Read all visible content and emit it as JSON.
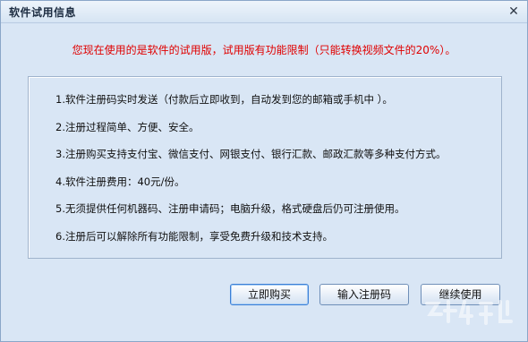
{
  "window": {
    "title": "软件试用信息",
    "close_glyph": "✕"
  },
  "notice": "您现在使用的是软件的试用版，试用版有功能限制（只能转换视频文件的20%）。",
  "info_items": [
    {
      "label": "1.软件注册码实时发送（付款后立即收到，自动发到您的邮箱或手机中 ）。"
    },
    {
      "label": "2.注册过程简单、方便、安全。"
    },
    {
      "label": "3.注册购买支持支付宝、微信支付、网银支付、银行汇款、邮政汇款等多种支付方式。"
    },
    {
      "label": "4.软件注册费用：40元/份。"
    },
    {
      "label": "5.无须提供任何机器码、注册申请码；电脑升级，格式硬盘后仍可注册使用。"
    },
    {
      "label": "6.注册后可以解除所有功能限制，享受免费升级和技术支持。"
    }
  ],
  "buttons": {
    "buy_now": "立即购买",
    "enter_code": "输入注册码",
    "continue": "继续使用"
  },
  "colors": {
    "background": "#d9e6f5",
    "notice_text": "#e00000",
    "border": "#8aa6c8"
  }
}
